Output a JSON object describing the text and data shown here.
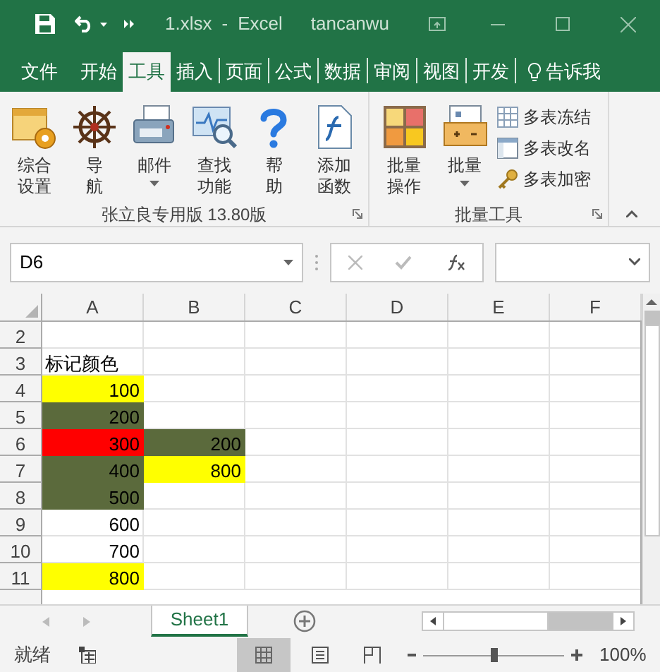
{
  "title_bar": {
    "file": "1.xlsx",
    "separator": "-",
    "app": "Excel",
    "user": "tancanwu"
  },
  "ribbon_tabs": [
    {
      "label": "文件",
      "selected": false
    },
    {
      "label": "开始",
      "selected": false
    },
    {
      "label": "工具",
      "selected": true
    },
    {
      "label": "插入",
      "selected": false
    },
    {
      "label": "页面",
      "selected": false
    },
    {
      "label": "公式",
      "selected": false
    },
    {
      "label": "数据",
      "selected": false
    },
    {
      "label": "审阅",
      "selected": false
    },
    {
      "label": "视图",
      "selected": false
    },
    {
      "label": "开发",
      "selected": false
    }
  ],
  "tell_me": "告诉我",
  "ribbon_groups": [
    {
      "label": "张立良专用版 13.80版",
      "buttons": [
        {
          "kind": "large",
          "lines": [
            "综合",
            "设置"
          ],
          "dropdown": false
        },
        {
          "kind": "large",
          "lines": [
            "导",
            "航"
          ],
          "dropdown": false
        },
        {
          "kind": "large",
          "lines": [
            "邮件"
          ],
          "dropdown": true
        },
        {
          "kind": "large",
          "lines": [
            "查找",
            "功能"
          ],
          "dropdown": false
        },
        {
          "kind": "large",
          "lines": [
            "帮",
            "助"
          ],
          "dropdown": false
        },
        {
          "kind": "large",
          "lines": [
            "添加",
            "函数"
          ],
          "dropdown": false
        }
      ]
    },
    {
      "label": "批量工具",
      "buttons": [
        {
          "kind": "large",
          "lines": [
            "批量",
            "操作"
          ],
          "dropdown": false
        },
        {
          "kind": "large",
          "lines": [
            "批量"
          ],
          "dropdown": true
        },
        {
          "kind": "small",
          "lines": [
            "多表冻结"
          ]
        },
        {
          "kind": "small",
          "lines": [
            "多表改名"
          ]
        },
        {
          "kind": "small",
          "lines": [
            "多表加密"
          ]
        }
      ]
    }
  ],
  "name_box": "D6",
  "columns": [
    "A",
    "B",
    "C",
    "D",
    "E",
    "F"
  ],
  "rows": [
    {
      "header": "2"
    },
    {
      "header": "3",
      "a": {
        "kind": "text",
        "text": "标记颜色"
      }
    },
    {
      "header": "4",
      "a": {
        "kind": "number",
        "text": "100",
        "color": "#ffff00"
      }
    },
    {
      "header": "5",
      "a": {
        "kind": "number",
        "text": "200",
        "color": "#5b6a3c"
      }
    },
    {
      "header": "6",
      "a": {
        "kind": "number",
        "text": "300",
        "color": "#ff0000"
      },
      "b": {
        "kind": "number",
        "text": "200",
        "color": "#5b6a3c"
      }
    },
    {
      "header": "7",
      "a": {
        "kind": "number",
        "text": "400",
        "color": "#5b6a3c"
      },
      "b": {
        "kind": "number",
        "text": "800",
        "color": "#ffff00"
      }
    },
    {
      "header": "8",
      "a": {
        "kind": "number",
        "text": "500",
        "color": "#5b6a3c"
      }
    },
    {
      "header": "9",
      "a": {
        "kind": "number",
        "text": "600"
      }
    },
    {
      "header": "10",
      "a": {
        "kind": "number",
        "text": "700"
      }
    },
    {
      "header": "11",
      "a": {
        "kind": "number",
        "text": "800",
        "color": "#ffff00"
      }
    }
  ],
  "sheet_tabs": [
    {
      "label": "Sheet1",
      "selected": true
    }
  ],
  "status": "就绪",
  "zoom": {
    "level": 0.5,
    "reading": "100%"
  }
}
